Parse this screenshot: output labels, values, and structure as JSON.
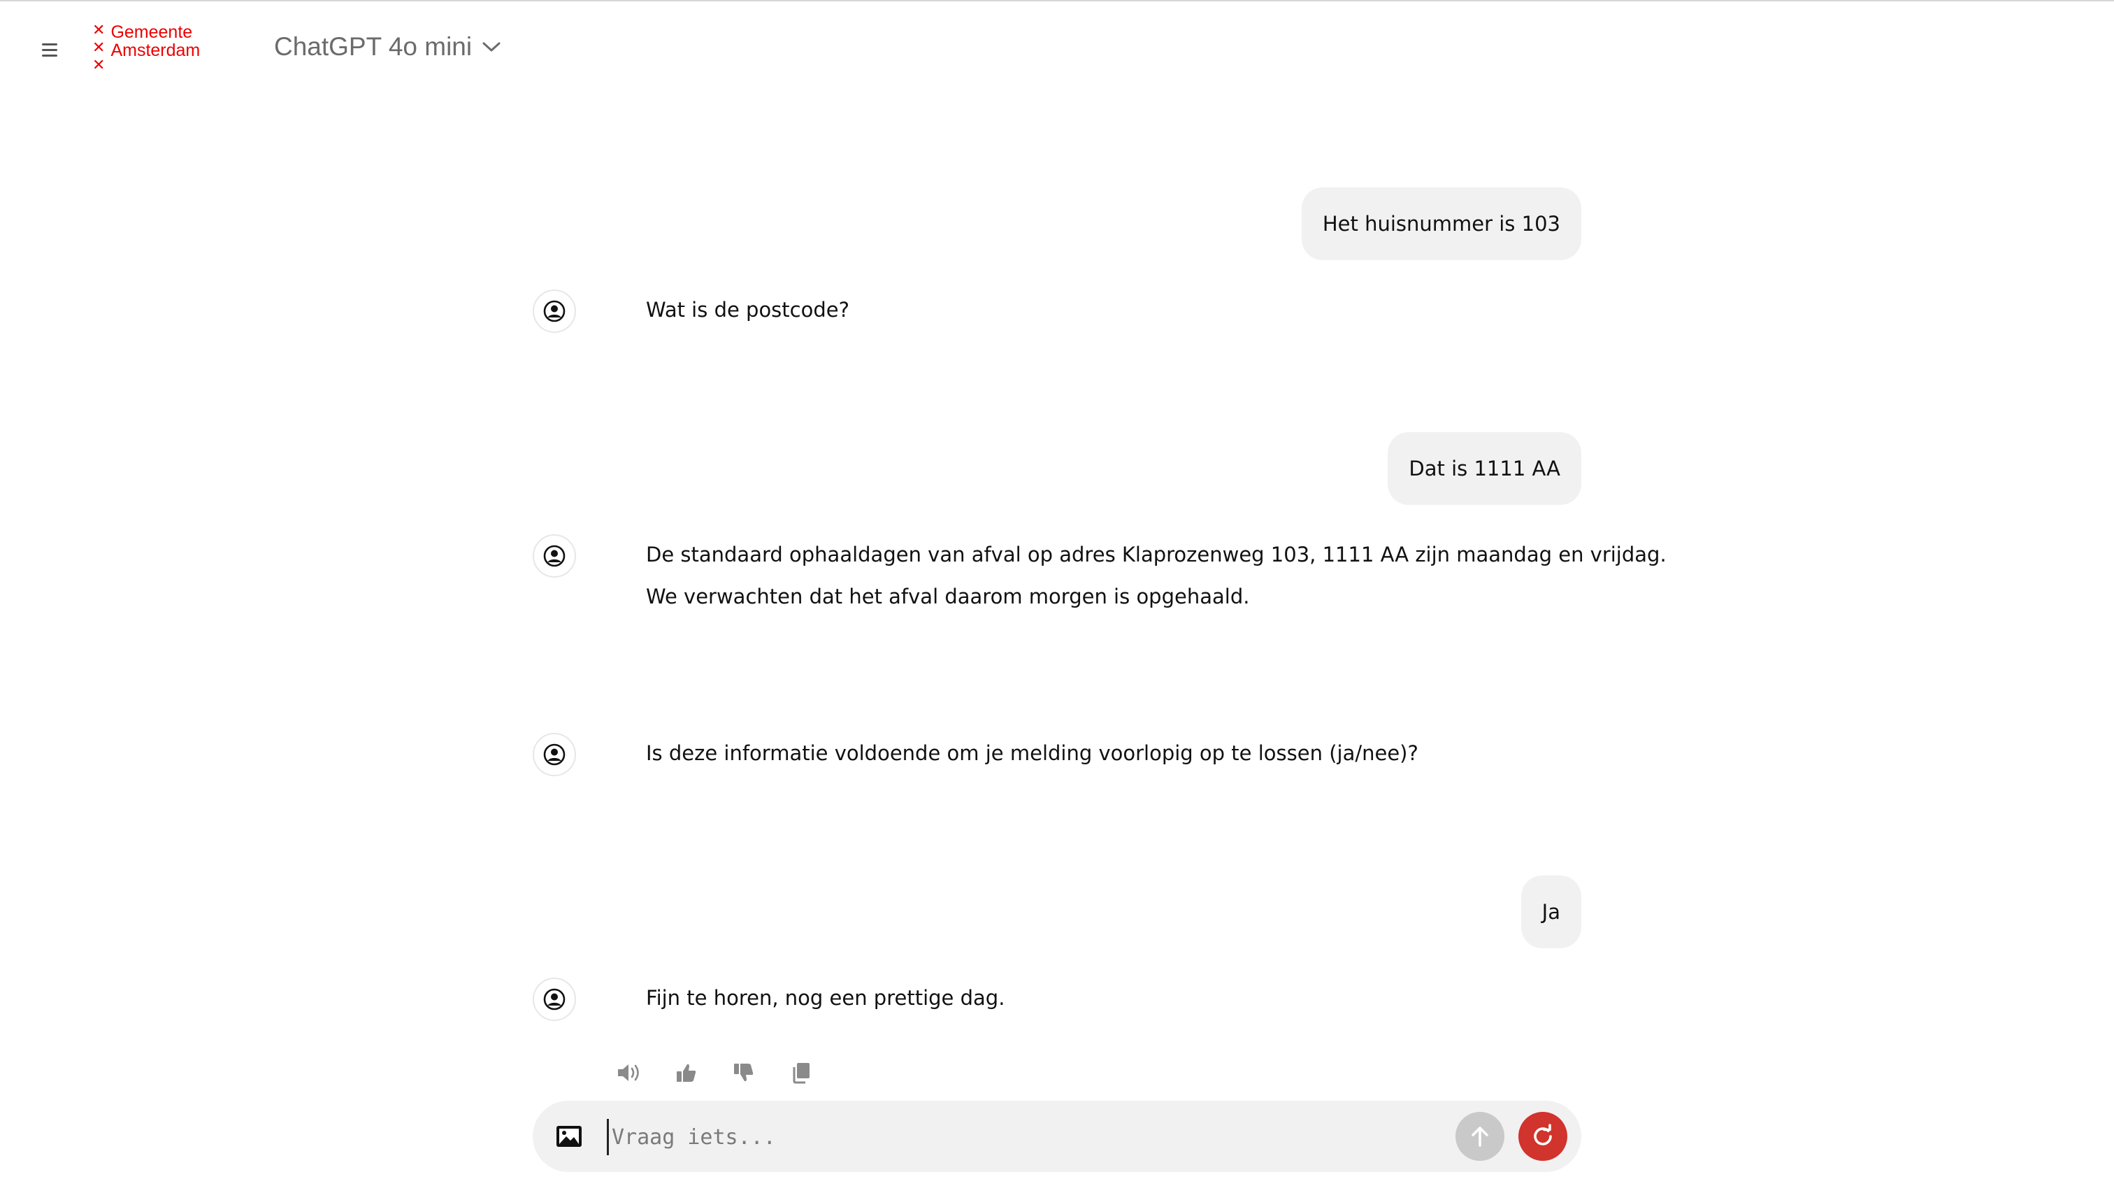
{
  "header": {
    "logo_line1": "Gemeente",
    "logo_line2": "Amsterdam",
    "model_label": "ChatGPT 4o mini"
  },
  "messages": [
    {
      "role": "user",
      "text": "Het huisnummer is 103"
    },
    {
      "role": "assistant",
      "lines": [
        "Wat is de postcode?"
      ]
    },
    {
      "role": "user",
      "text": "Dat is 1111 AA"
    },
    {
      "role": "assistant",
      "lines": [
        "De standaard ophaaldagen van afval op adres Klaprozenweg 103, 1111 AA zijn maandag en vrijdag.",
        "We verwachten dat het afval daarom morgen is opgehaald."
      ]
    },
    {
      "role": "assistant",
      "lines": [
        "Is deze informatie voldoende om je melding voorlopig op te lossen (ja/nee)?"
      ]
    },
    {
      "role": "user",
      "text": "Ja"
    },
    {
      "role": "assistant",
      "lines": [
        "Fijn te horen, nog een prettige dag."
      ]
    }
  ],
  "composer": {
    "placeholder": "Vraag iets...",
    "value": ""
  },
  "colors": {
    "brand_red": "#ec0000",
    "reset_button": "#d0342c",
    "bubble_bg": "#f1f1f1"
  }
}
